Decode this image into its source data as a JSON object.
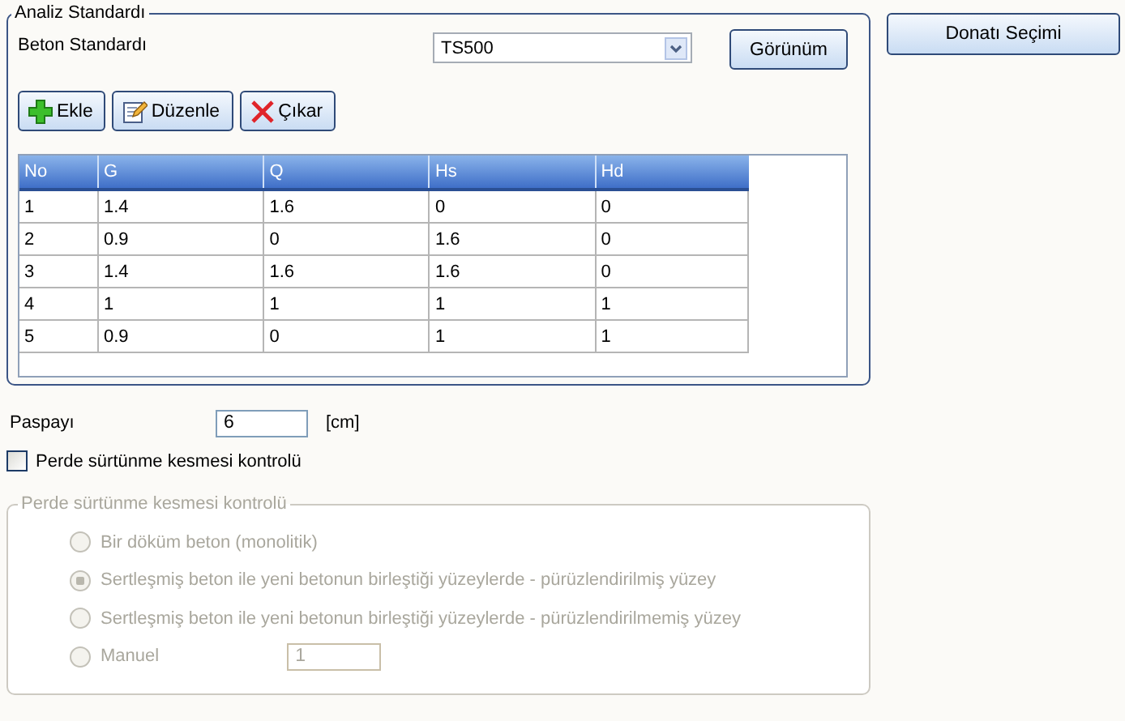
{
  "analysis_group": {
    "title": "Analiz Standardı",
    "concrete_standard_label": "Beton Standardı",
    "concrete_standard_value": "TS500",
    "view_button": "Görünüm",
    "toolbar": [
      {
        "kind": "add",
        "label": "Ekle"
      },
      {
        "kind": "edit",
        "label": "Düzenle"
      },
      {
        "kind": "remove",
        "label": "Çıkar"
      }
    ],
    "table": {
      "columns": [
        "No",
        "G",
        "Q",
        "Hs",
        "Hd"
      ],
      "rows": [
        [
          "1",
          "1.4",
          "1.6",
          "0",
          "0"
        ],
        [
          "2",
          "0.9",
          "0",
          "1.6",
          "0"
        ],
        [
          "3",
          "1.4",
          "1.6",
          "1.6",
          "0"
        ],
        [
          "4",
          "1",
          "1",
          "1",
          "1"
        ],
        [
          "5",
          "0.9",
          "0",
          "1",
          "1"
        ]
      ]
    }
  },
  "reinforcement_button": "Donatı Seçimi",
  "cover": {
    "label": "Paspayı",
    "value": "6",
    "unit": "[cm]"
  },
  "friction_check": {
    "label": "Perde sürtünme kesmesi kontrolü",
    "checked": false
  },
  "friction_group": {
    "title": "Perde sürtünme kesmesi kontrolü",
    "disabled": true,
    "options": [
      {
        "label": "Bir döküm beton (monolitik)",
        "selected": false
      },
      {
        "label": "Sertleşmiş beton ile yeni betonun birleştiği yüzeylerde - pürüzlendirilmiş yüzey",
        "selected": true
      },
      {
        "label": "Sertleşmiş beton ile yeni betonun birleştiği yüzeylerde - pürüzlendirilmemiş yüzey",
        "selected": false
      },
      {
        "label": "Manuel",
        "selected": false,
        "value": "1"
      }
    ]
  }
}
